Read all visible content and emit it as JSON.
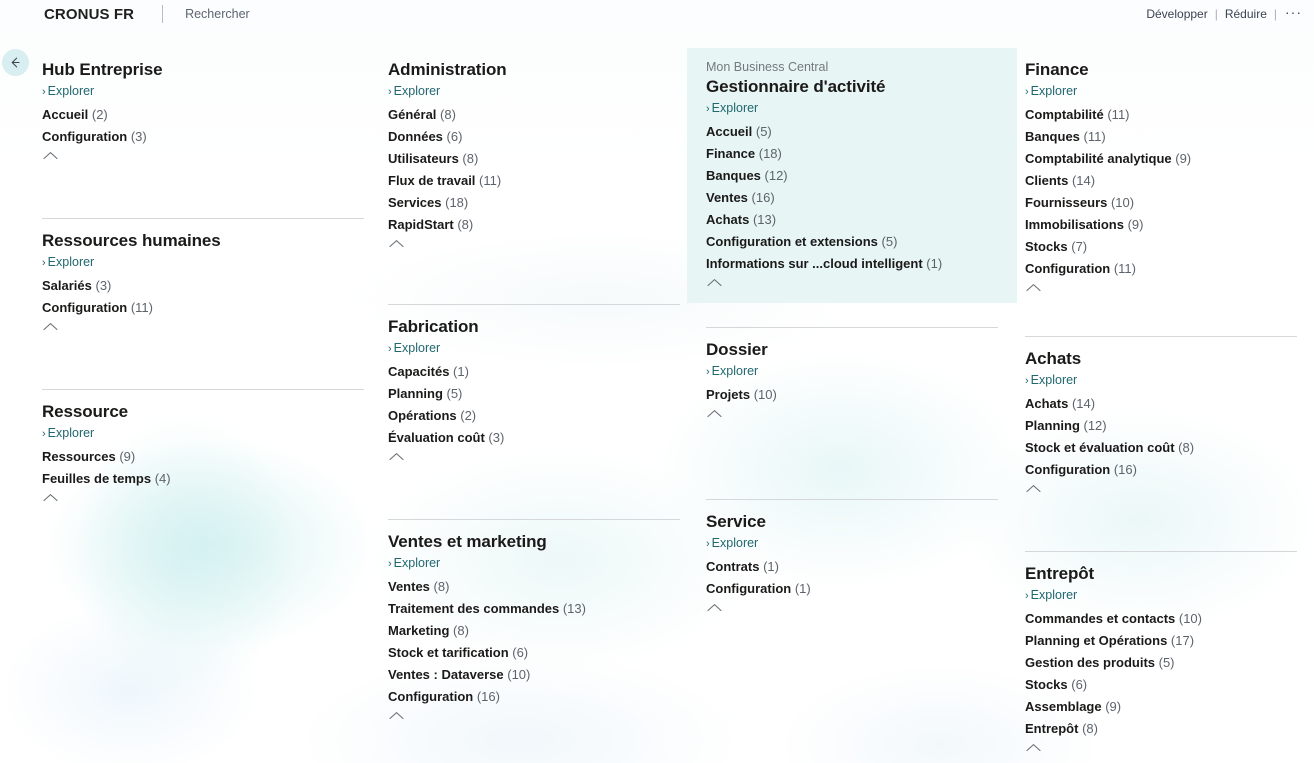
{
  "topbar": {
    "brand": "CRONUS FR",
    "search_label": "Rechercher",
    "expand_label": "Développer",
    "collapse_label": "Réduire",
    "more_label": "···",
    "separator": "|"
  },
  "back_button": {
    "name": "back-arrow"
  },
  "common": {
    "explore_label": "Explorer",
    "chevron_right": "›"
  },
  "colors": {
    "accent_teal": "#20676f",
    "highlight_bg": "#e7f5f5",
    "back_button_bg": "#d8eef0",
    "text": "#1b1a19",
    "count_text": "#5d636b",
    "divider": "#d5d7da"
  },
  "columns": [
    {
      "id": "column-1",
      "groups": [
        {
          "id": "hub-entreprise",
          "title": "Hub Entreprise",
          "supertitle": null,
          "highlight": false,
          "items": [
            {
              "label": "Accueil",
              "count": "(2)"
            },
            {
              "label": "Configuration",
              "count": "(3)"
            }
          ],
          "spacer_after": 42,
          "divider_after": true
        },
        {
          "id": "ressources-humaines",
          "title": "Ressources humaines",
          "supertitle": null,
          "highlight": false,
          "items": [
            {
              "label": "Salariés",
              "count": "(3)"
            },
            {
              "label": "Configuration",
              "count": "(11)"
            }
          ],
          "spacer_after": 42,
          "divider_after": true
        },
        {
          "id": "ressource",
          "title": "Ressource",
          "supertitle": null,
          "highlight": false,
          "items": [
            {
              "label": "Ressources",
              "count": "(9)"
            },
            {
              "label": "Feuilles de temps",
              "count": "(4)"
            }
          ],
          "spacer_after": 0,
          "divider_after": false
        }
      ]
    },
    {
      "id": "column-2",
      "groups": [
        {
          "id": "administration",
          "title": "Administration",
          "supertitle": null,
          "highlight": false,
          "items": [
            {
              "label": "Général",
              "count": "(8)"
            },
            {
              "label": "Données",
              "count": "(6)"
            },
            {
              "label": "Utilisateurs",
              "count": "(8)"
            },
            {
              "label": "Flux de travail",
              "count": "(11)"
            },
            {
              "label": "Services",
              "count": "(18)"
            },
            {
              "label": "RapidStart",
              "count": "(8)"
            }
          ],
          "spacer_after": 40,
          "divider_after": true
        },
        {
          "id": "fabrication",
          "title": "Fabrication",
          "supertitle": null,
          "highlight": false,
          "items": [
            {
              "label": "Capacités",
              "count": "(1)"
            },
            {
              "label": "Planning",
              "count": "(5)"
            },
            {
              "label": "Opérations",
              "count": "(2)"
            },
            {
              "label": "Évaluation coût",
              "count": "(3)"
            }
          ],
          "spacer_after": 42,
          "divider_after": true
        },
        {
          "id": "ventes-et-marketing",
          "title": "Ventes et marketing",
          "supertitle": null,
          "highlight": false,
          "items": [
            {
              "label": "Ventes",
              "count": "(8)"
            },
            {
              "label": "Traitement des commandes",
              "count": "(13)"
            },
            {
              "label": "Marketing",
              "count": "(8)"
            },
            {
              "label": "Stock et tarification",
              "count": "(6)"
            },
            {
              "label": "Ventes : Dataverse",
              "count": "(10)"
            },
            {
              "label": "Configuration",
              "count": "(16)"
            }
          ],
          "spacer_after": 0,
          "divider_after": false
        }
      ]
    },
    {
      "id": "column-3",
      "groups": [
        {
          "id": "gestionnaire-d-activite",
          "title": "Gestionnaire d'activité",
          "supertitle": "Mon Business Central",
          "highlight": true,
          "items": [
            {
              "label": "Accueil",
              "count": "(5)"
            },
            {
              "label": "Finance",
              "count": "(18)"
            },
            {
              "label": "Banques",
              "count": "(12)"
            },
            {
              "label": "Ventes",
              "count": "(16)"
            },
            {
              "label": "Achats",
              "count": "(13)"
            },
            {
              "label": "Configuration et extensions",
              "count": "(5)"
            },
            {
              "label": "Informations sur ...cloud intelligent",
              "count": "(1)"
            }
          ],
          "spacer_after": 24,
          "divider_after": true
        },
        {
          "id": "dossier",
          "title": "Dossier",
          "supertitle": null,
          "highlight": false,
          "items": [
            {
              "label": "Projets",
              "count": "(10)"
            }
          ],
          "spacer_after": 65,
          "divider_after": true
        },
        {
          "id": "service",
          "title": "Service",
          "supertitle": null,
          "highlight": false,
          "items": [
            {
              "label": "Contrats",
              "count": "(1)"
            },
            {
              "label": "Configuration",
              "count": "(1)"
            }
          ],
          "spacer_after": 0,
          "divider_after": false
        }
      ]
    },
    {
      "id": "column-4",
      "groups": [
        {
          "id": "finance",
          "title": "Finance",
          "supertitle": null,
          "highlight": false,
          "items": [
            {
              "label": "Comptabilité",
              "count": "(11)"
            },
            {
              "label": "Banques",
              "count": "(11)"
            },
            {
              "label": "Comptabilité analytique",
              "count": "(9)"
            },
            {
              "label": "Clients",
              "count": "(14)"
            },
            {
              "label": "Fournisseurs",
              "count": "(10)"
            },
            {
              "label": "Immobilisations",
              "count": "(9)"
            },
            {
              "label": "Stocks",
              "count": "(7)"
            },
            {
              "label": "Configuration",
              "count": "(11)"
            }
          ],
          "spacer_after": 28,
          "divider_after": true
        },
        {
          "id": "achats",
          "title": "Achats",
          "supertitle": null,
          "highlight": false,
          "items": [
            {
              "label": "Achats",
              "count": "(14)"
            },
            {
              "label": "Planning",
              "count": "(12)"
            },
            {
              "label": "Stock et évaluation coût",
              "count": "(8)"
            },
            {
              "label": "Configuration",
              "count": "(16)"
            }
          ],
          "spacer_after": 42,
          "divider_after": true
        },
        {
          "id": "entrepot",
          "title": "Entrepôt",
          "supertitle": null,
          "highlight": false,
          "items": [
            {
              "label": "Commandes et contacts",
              "count": "(10)"
            },
            {
              "label": "Planning et Opérations",
              "count": "(17)"
            },
            {
              "label": "Gestion des produits",
              "count": "(5)"
            },
            {
              "label": "Stocks",
              "count": "(6)"
            },
            {
              "label": "Assemblage",
              "count": "(9)"
            },
            {
              "label": "Entrepôt",
              "count": "(8)"
            }
          ],
          "spacer_after": 0,
          "divider_after": false
        }
      ]
    }
  ]
}
